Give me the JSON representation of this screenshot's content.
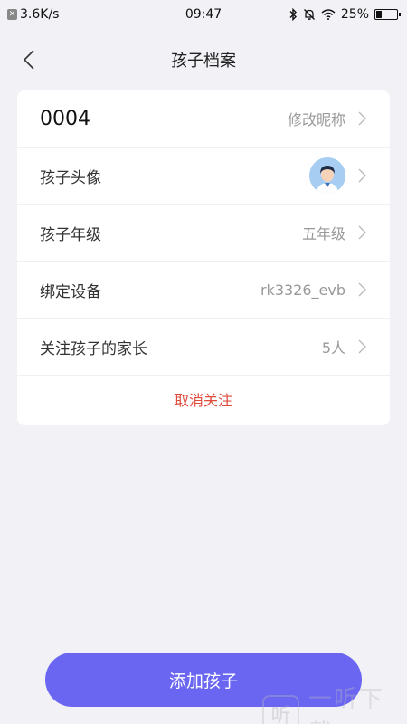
{
  "status_bar": {
    "net_speed": "3.6K/s",
    "time": "09:47",
    "battery": "25%",
    "battery_level": 0.25
  },
  "nav": {
    "title": "孩子档案"
  },
  "profile": {
    "nickname": "0004",
    "edit_nickname_label": "修改昵称",
    "rows": [
      {
        "label": "孩子头像",
        "value": ""
      },
      {
        "label": "孩子年级",
        "value": "五年级"
      },
      {
        "label": "绑定设备",
        "value": "rk3326_evb"
      },
      {
        "label": "关注孩子的家长",
        "value": "5人"
      }
    ],
    "unfollow_label": "取消关注"
  },
  "add_child_button": "添加孩子",
  "watermark": {
    "logo": "听",
    "text": "一听下载"
  },
  "colors": {
    "accent": "#6a66f2",
    "danger": "#e04b3c",
    "background": "#f1f1f6"
  }
}
